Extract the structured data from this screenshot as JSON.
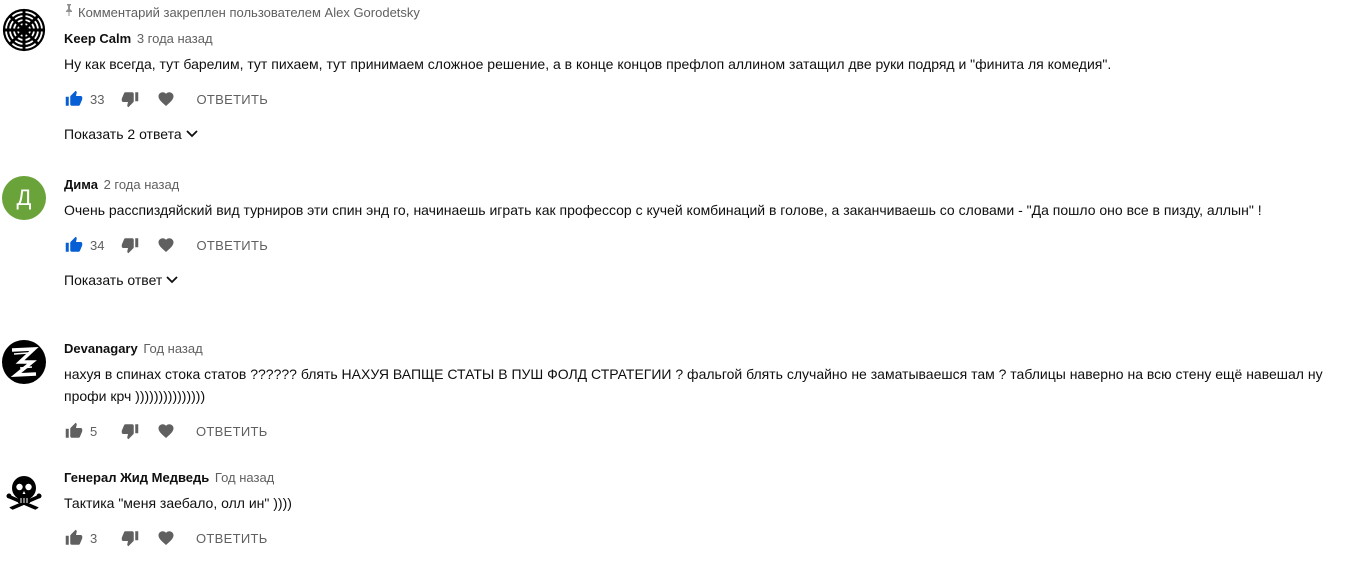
{
  "pinned_text": "Комментарий закреплен пользователем Alex Gorodetsky",
  "reply_label": "ОТВЕТИТЬ",
  "colors": {
    "like_active": "#065fd4",
    "icon_gray": "#606060",
    "avatar_green": "#6aa33a"
  },
  "comments": [
    {
      "author": "Keep Calm",
      "time": "3 года назад",
      "text": "Ну как всегда, тут барелим, тут пихаем, тут  принимаем сложное решение,  а в конце концов префлоп аллином затащил две руки подряд и \"финита ля комедия\".",
      "likes": "33",
      "show_replies": "Показать 2 ответа",
      "avatar_icon": "hypno-spiral-avatar"
    },
    {
      "author": "Дима",
      "time": "2 года назад",
      "text": "Очень расспиздяйский вид турниров эти спин энд го, начинаешь играть как профессор с кучей комбинаций в голове, а заканчиваешь со словами - \"Да пошло оно все в пизду, аллын\" !",
      "likes": "34",
      "show_replies": "Показать ответ",
      "avatar_letter": "Д"
    },
    {
      "author": "Devanagary",
      "time": "Год назад",
      "text": "нахуя в спинах стока статов ?????? блять НАХУЯ ВАПЩЕ СТАТЫ В ПУШ ФОЛД СТРАТЕГИИ ? фальгой блять случайно не заматываешся там ? таблицы наверно на всю стену ещё навешал ну профи крч )))))))))))))))",
      "likes": "5",
      "avatar_icon": "z-logo-avatar"
    },
    {
      "author": "Генерал Жид Медведь",
      "time": "Год назад",
      "text": "Тактика \"меня заебало, олл ин\" ))))",
      "likes": "3",
      "avatar_icon": "skull-crossbones-avatar"
    }
  ]
}
